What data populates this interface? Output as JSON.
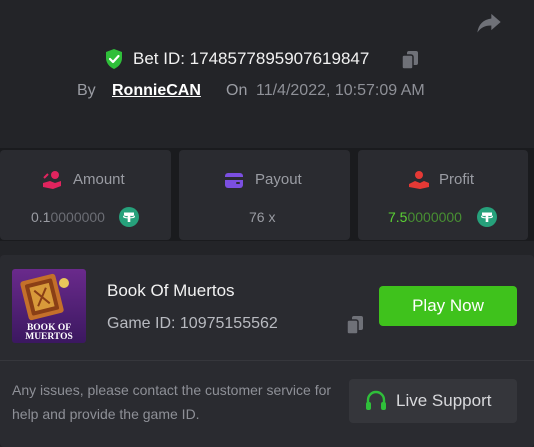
{
  "bet": {
    "id_label": "Bet ID: 1748577895907619847",
    "by_label": "By",
    "username": "RonnieCAN",
    "on_label": "On",
    "datetime": "11/4/2022, 10:57:09 AM"
  },
  "stats": {
    "amount": {
      "label": "Amount",
      "value_main": "0.1",
      "value_dim": "0000000",
      "currency_icon": "tether-icon"
    },
    "payout": {
      "label": "Payout",
      "value": "76 x"
    },
    "profit": {
      "label": "Profit",
      "value_main": "7.5",
      "value_dim": "0000000",
      "currency_icon": "tether-icon"
    }
  },
  "game": {
    "title": "Book Of Muertos",
    "id_label": "Game ID: 10975155562",
    "thumb_text_1": "BOOK OF",
    "thumb_text_2": "MUERTOS",
    "play_label": "Play Now"
  },
  "support": {
    "help_text": "Any issues, please contact the customer service for help and provide the game ID.",
    "live_label": "Live Support"
  },
  "colors": {
    "background": "#232428",
    "card": "#2a2b30",
    "accent_green": "#3fc21c",
    "profit_green": "#5bd134",
    "tether": "#26a17b",
    "amount_icon": "#e0245e",
    "payout_icon": "#7b4fe0",
    "profit_icon": "#e53935"
  }
}
